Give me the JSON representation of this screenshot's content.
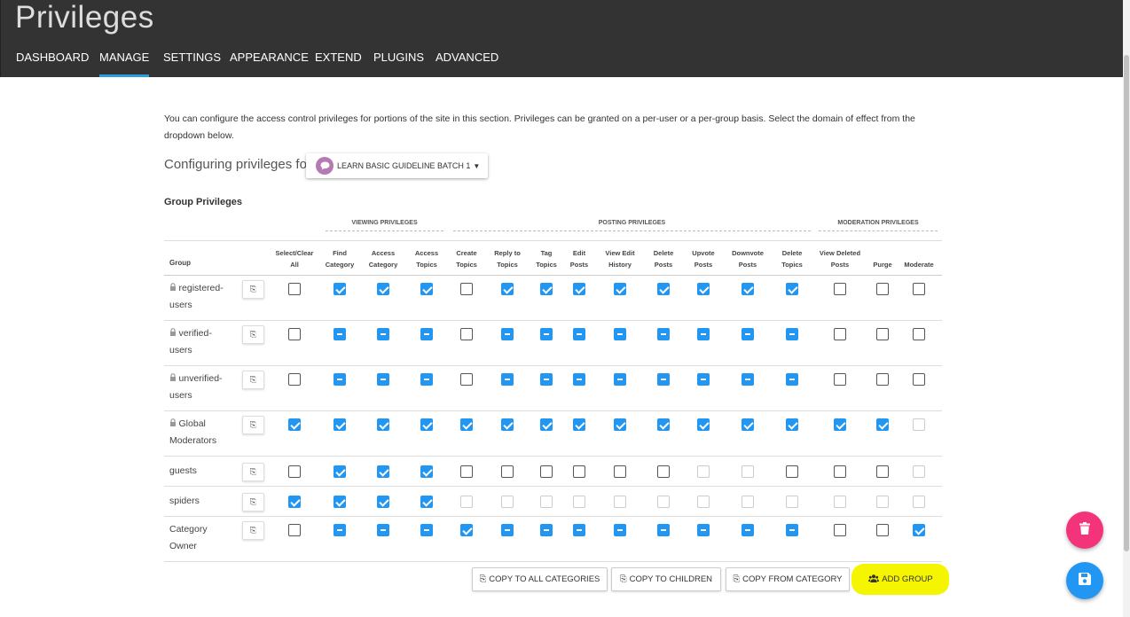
{
  "header": {
    "title": "Privileges",
    "nav": [
      "DASHBOARD",
      "MANAGE",
      "SETTINGS",
      "APPEARANCE",
      "EXTEND",
      "PLUGINS",
      "ADVANCED"
    ],
    "active_tab": "MANAGE"
  },
  "intro": "You can configure the access control privileges for portions of the site in this section. Privileges can be granted on a per-user or a per-group basis. Select the domain of effect from the dropdown below.",
  "config": {
    "label": "Configuring privileges for",
    "selected_category": "LEARN BASIC GUIDELINE BATCH 1"
  },
  "section_title": "Group Privileges",
  "privilege_groups": [
    "VIEWING PRIVILEGES",
    "POSTING PRIVILEGES",
    "MODERATION PRIVILEGES"
  ],
  "table": {
    "group_header": "Group",
    "columns": [
      [
        "Select/Clear",
        "All"
      ],
      [
        "Find",
        "Category"
      ],
      [
        "Access",
        "Category"
      ],
      [
        "Access",
        "Topics"
      ],
      [
        "Create",
        "Topics"
      ],
      [
        "Reply to",
        "Topics"
      ],
      [
        "Tag",
        "Topics"
      ],
      [
        "Edit",
        "Posts"
      ],
      [
        "View Edit",
        "History"
      ],
      [
        "Delete",
        "Posts"
      ],
      [
        "Upvote",
        "Posts"
      ],
      [
        "Downvote",
        "Posts"
      ],
      [
        "Delete",
        "Topics"
      ],
      [
        "View Deleted",
        "Posts"
      ],
      [
        "Purge",
        ""
      ],
      [
        "Moderate",
        ""
      ]
    ],
    "rows": [
      {
        "name_line1": "registered-",
        "name_line2": "users",
        "locked": true,
        "states": [
          "off",
          "on",
          "on",
          "on",
          "off",
          "on",
          "on",
          "on",
          "on",
          "on",
          "on",
          "on",
          "on",
          "off",
          "off",
          "off"
        ]
      },
      {
        "name_line1": "verified-",
        "name_line2": "users",
        "locked": true,
        "states": [
          "off",
          "ind",
          "ind",
          "ind",
          "off",
          "ind",
          "ind",
          "ind",
          "ind",
          "ind",
          "ind",
          "ind",
          "ind",
          "off",
          "off",
          "off"
        ]
      },
      {
        "name_line1": "unverified-",
        "name_line2": "users",
        "locked": true,
        "states": [
          "off",
          "ind",
          "ind",
          "ind",
          "off",
          "ind",
          "ind",
          "ind",
          "ind",
          "ind",
          "ind",
          "ind",
          "ind",
          "off",
          "off",
          "off"
        ]
      },
      {
        "name_line1": "Global",
        "name_line2": "Moderators",
        "locked": true,
        "states": [
          "on",
          "on",
          "on",
          "on",
          "on",
          "on",
          "on",
          "on",
          "on",
          "on",
          "on",
          "on",
          "on",
          "on",
          "on",
          "dis"
        ]
      },
      {
        "name_line1": "guests",
        "name_line2": "",
        "locked": false,
        "states": [
          "off",
          "on",
          "on",
          "on",
          "off",
          "off",
          "off",
          "off",
          "off",
          "off",
          "dis",
          "dis",
          "off",
          "off",
          "off",
          "dis"
        ]
      },
      {
        "name_line1": "spiders",
        "name_line2": "",
        "locked": false,
        "states": [
          "on",
          "on",
          "on",
          "on",
          "dis",
          "dis",
          "dis",
          "dis",
          "dis",
          "dis",
          "dis",
          "dis",
          "dis",
          "dis",
          "dis",
          "dis"
        ]
      },
      {
        "name_line1": "Category",
        "name_line2": "Owner",
        "locked": false,
        "states": [
          "off",
          "ind",
          "ind",
          "ind",
          "on",
          "ind",
          "ind",
          "ind",
          "ind",
          "ind",
          "ind",
          "ind",
          "ind",
          "off",
          "off",
          "on"
        ]
      }
    ]
  },
  "actions": {
    "copy_all": "COPY TO ALL CATEGORIES",
    "copy_children": "COPY TO CHILDREN",
    "copy_from": "COPY FROM CATEGORY",
    "add_group": "ADD GROUP"
  },
  "colors": {
    "accent": "#2196f3",
    "delete": "#f3337a",
    "highlight": "#f5f500",
    "topbar": "#333333"
  }
}
